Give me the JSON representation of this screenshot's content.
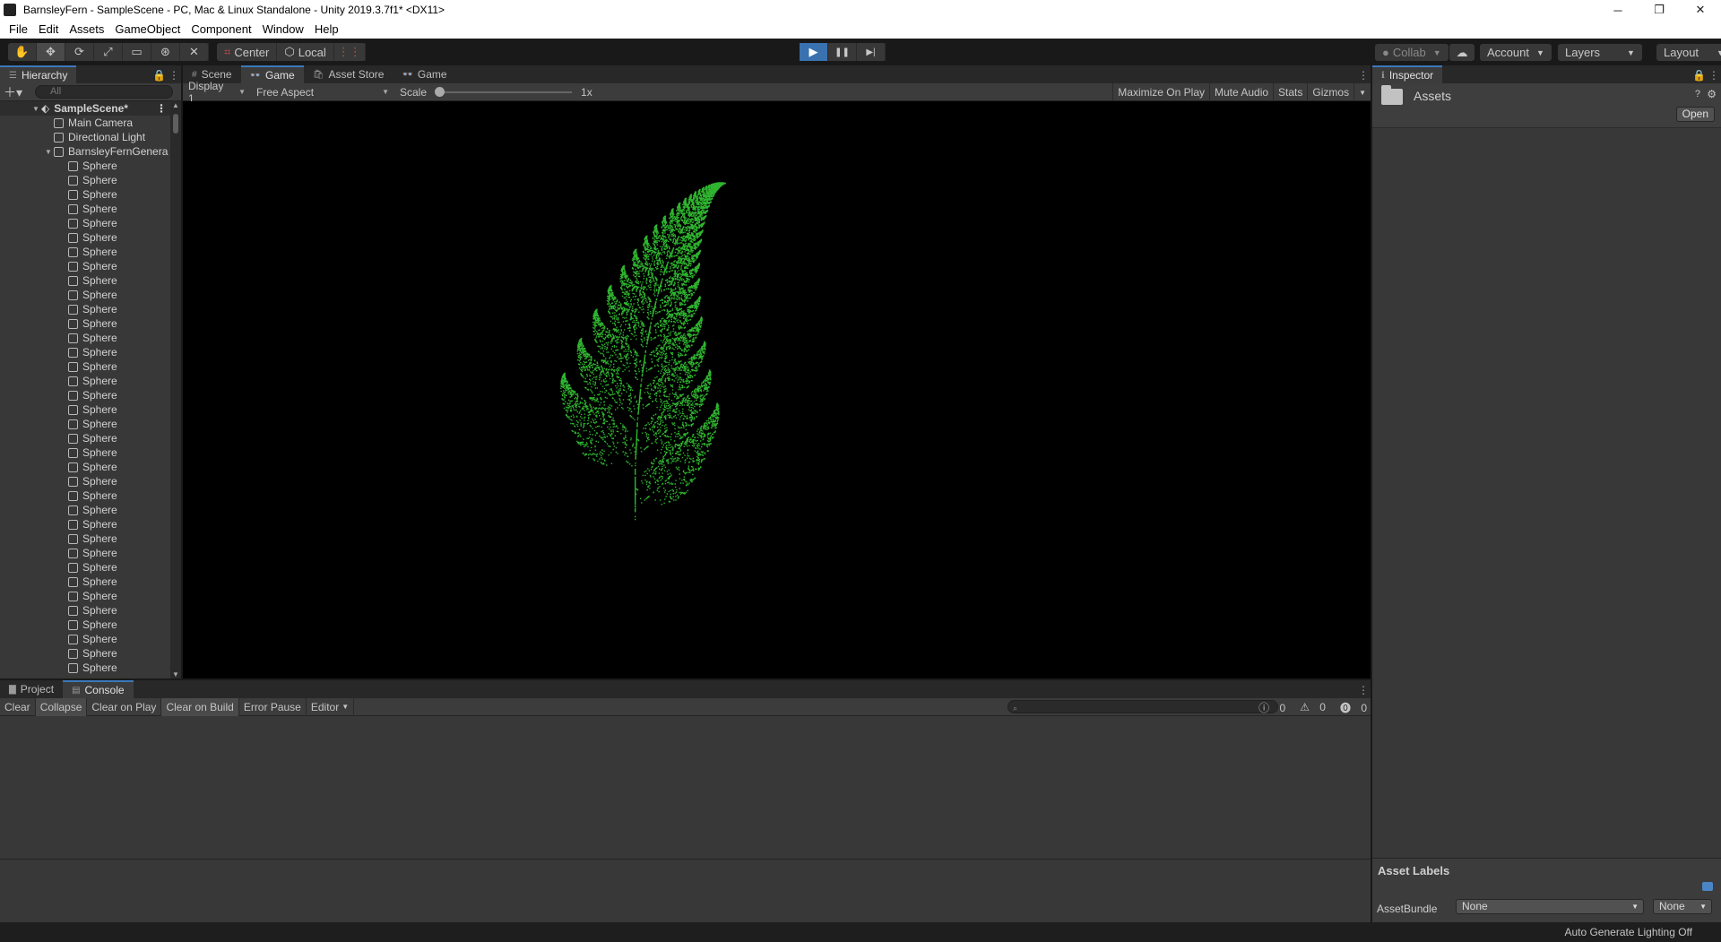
{
  "window": {
    "title": "BarnsleyFern - SampleScene - PC, Mac & Linux Standalone - Unity 2019.3.7f1* <DX11>",
    "controls": [
      "─",
      "❐",
      "✕"
    ]
  },
  "menu": [
    "File",
    "Edit",
    "Assets",
    "GameObject",
    "Component",
    "Window",
    "Help"
  ],
  "toolbar": {
    "tools": [
      "hand-icon",
      "move-icon",
      "rotate-icon",
      "scale-icon",
      "rect-icon",
      "transform-icon",
      "custom-tool-icon"
    ],
    "pivot_mode": "Center",
    "pivot_rotation": "Local",
    "play": "▶",
    "pause": "❚❚",
    "step": "▶|",
    "collab": "Collab",
    "account": "Account",
    "layers": "Layers",
    "layout": "Layout"
  },
  "hierarchy": {
    "tab": "Hierarchy",
    "search_placeholder": "All",
    "scene": "SampleScene*",
    "items": [
      {
        "label": "Main Camera",
        "indent": 1
      },
      {
        "label": "Directional Light",
        "indent": 1
      },
      {
        "label": "BarnsleyFernGenera",
        "indent": 1,
        "expanded": true
      }
    ],
    "child_label": "Sphere",
    "child_count": 36
  },
  "center_tabs": [
    {
      "label": "Scene",
      "icon": "#"
    },
    {
      "label": "Game",
      "icon": "👓",
      "active": true
    },
    {
      "label": "Asset Store",
      "icon": "🛍"
    },
    {
      "label": "Game",
      "icon": "👓"
    }
  ],
  "game_view": {
    "display": "Display 1",
    "aspect": "Free Aspect",
    "scale_label": "Scale",
    "scale_value": "1x",
    "maximize": "Maximize On Play",
    "mute": "Mute Audio",
    "stats": "Stats",
    "gizmos": "Gizmos",
    "fern_color": "#2fb52f"
  },
  "inspector": {
    "tab": "Inspector",
    "title": "Assets",
    "open": "Open",
    "asset_labels": "Asset Labels",
    "assetbundle_label": "AssetBundle",
    "assetbundle_value": "None",
    "variant_value": "None"
  },
  "bottom_tabs": [
    {
      "label": "Project",
      "icon": "▇"
    },
    {
      "label": "Console",
      "icon": "▤",
      "active": true
    }
  ],
  "console": {
    "buttons": [
      "Clear",
      "Collapse",
      "Clear on Play",
      "Clear on Build",
      "Error Pause",
      "Editor"
    ],
    "log_count": "0",
    "warn_count": "0",
    "error_count": "0"
  },
  "status": {
    "text": "Auto Generate Lighting Off"
  }
}
